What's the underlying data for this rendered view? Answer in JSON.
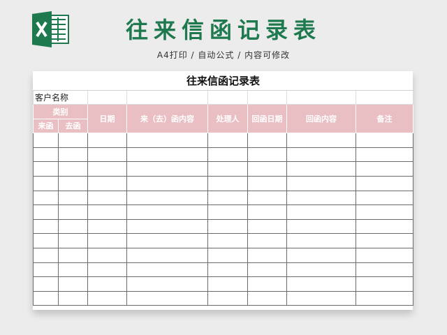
{
  "header": {
    "title": "往来信函记录表",
    "subtitle": "A4打印 / 自动公式 / 内容可修改",
    "icon": "excel-icon",
    "accent_color": "#1e7a4e"
  },
  "sheet": {
    "title": "往来信函记录表",
    "customer_label": "客户名称",
    "header_color": "#e9bfc3",
    "columns": {
      "category": "类别",
      "incoming": "来函",
      "outgoing": "去函",
      "date": "日期",
      "content": "来（去）函内容",
      "handler": "处理人",
      "reply_date": "回函日期",
      "reply_content": "回函内容",
      "notes": "备注"
    },
    "empty_rows": 12
  }
}
